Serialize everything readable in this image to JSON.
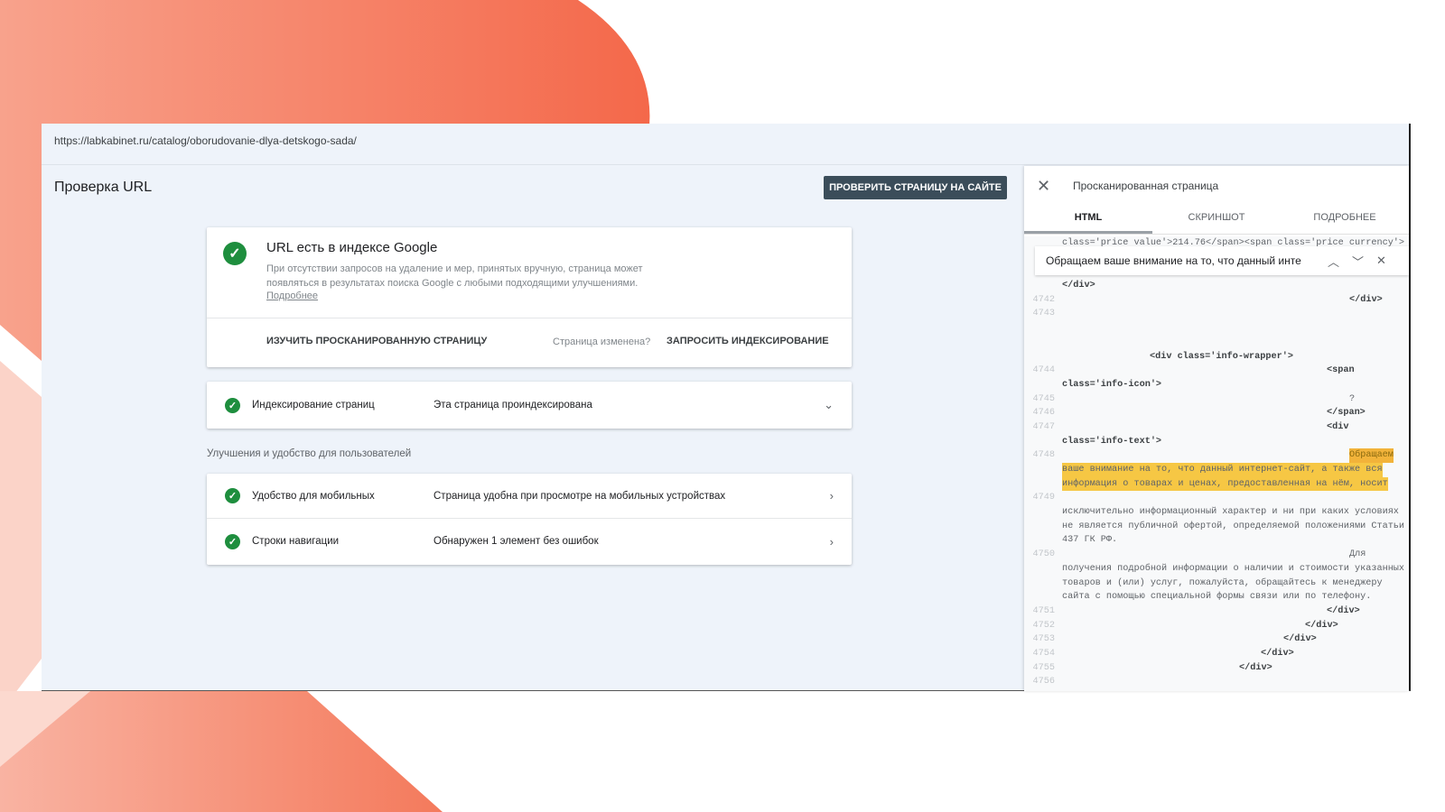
{
  "url": "https://labkabinet.ru/catalog/oborudovanie-dlya-detskogo-sada/",
  "page_title": "Проверка URL",
  "test_live_button": "ПРОВЕРИТЬ СТРАНИЦУ НА САЙТЕ",
  "index_card": {
    "title": "URL есть в индексе Google",
    "description": "При отсутствии запросов на удаление и мер, принятых вручную, страница может появляться в результатах поиска Google с любыми подходящими улучшениями.",
    "learn_more": "Подробнее",
    "view_crawled": "ИЗУЧИТЬ ПРОСКАНИРОВАННУЮ СТРАНИЦУ",
    "page_changed": "Страница изменена?",
    "request_indexing": "ЗАПРОСИТЬ ИНДЕКСИРОВАНИЕ"
  },
  "indexing_row": {
    "label": "Индексирование страниц",
    "value": "Эта страница проиндексирована"
  },
  "enhancements_title": "Улучшения и удобство для пользователей",
  "enhancements": [
    {
      "label": "Удобство для мобильных",
      "value": "Страница удобна при просмотре на мобильных устройствах"
    },
    {
      "label": "Строки навигации",
      "value": "Обнаружен 1 элемент без ошибок"
    }
  ],
  "panel": {
    "title": "Просканированная страница",
    "tabs": [
      "HTML",
      "СКРИНШОТ",
      "ПОДРОБНЕЕ"
    ],
    "search_value": "Обращаем ваше внимание на то, что данный инте",
    "code_lines": [
      {
        "n": "",
        "t": "class='price value'>214.76</span><span class='price currency'>"
      },
      {
        "n": "",
        "t": ""
      },
      {
        "n": "",
        "t": ""
      },
      {
        "n": "",
        "t": "</div>"
      },
      {
        "n": "4742",
        "t": "</div>"
      },
      {
        "n": "4743",
        "t": ""
      },
      {
        "n": "",
        "t": ""
      },
      {
        "n": "",
        "t": ""
      },
      {
        "n": "",
        "t": "<div class='info-wrapper'>"
      },
      {
        "n": "4744",
        "t": "<span"
      },
      {
        "n": "",
        "t": "class='info-icon'>"
      },
      {
        "n": "4745",
        "t": "?"
      },
      {
        "n": "4746",
        "t": "</span>"
      },
      {
        "n": "4747",
        "t": "<div"
      },
      {
        "n": "",
        "t": "class='info-text'>"
      },
      {
        "n": "4748",
        "t": "Обращаем"
      },
      {
        "n": "",
        "t": "ваше внимание на то, что данный интернет-сайт, а также вся"
      },
      {
        "n": "",
        "t": "информация о товарах и ценах, предоставленная на нём, носит"
      },
      {
        "n": "4749",
        "t": ""
      },
      {
        "n": "",
        "t": "исключительно информационный характер и ни при каких условиях"
      },
      {
        "n": "",
        "t": "не является публичной офертой, определяемой положениями Статьи"
      },
      {
        "n": "",
        "t": "437 ГК РФ."
      },
      {
        "n": "4750",
        "t": "Для"
      },
      {
        "n": "",
        "t": "получения подробной информации о наличии и стоимости указанных"
      },
      {
        "n": "",
        "t": "товаров и (или) услуг, пожалуйста, обращайтесь к менеджеру"
      },
      {
        "n": "",
        "t": "сайта с помощью специальной формы связи или по телефону."
      },
      {
        "n": "4751",
        "t": "</div>"
      },
      {
        "n": "4752",
        "t": "</div>"
      },
      {
        "n": "4753",
        "t": "</div>"
      },
      {
        "n": "4754",
        "t": "</div>"
      },
      {
        "n": "4755",
        "t": "</div>"
      },
      {
        "n": "4756",
        "t": ""
      }
    ]
  },
  "colors": {
    "accent_green": "#1e8e3e",
    "highlight": "#f6c744",
    "coral": "#f4704f"
  }
}
